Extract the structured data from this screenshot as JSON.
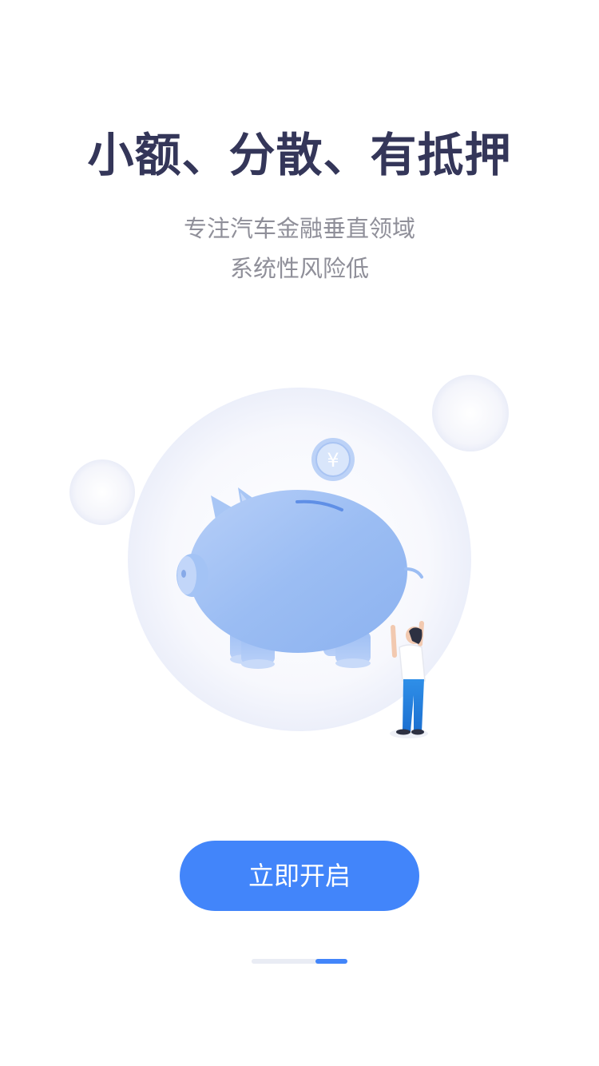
{
  "headline": "小额、分散、有抵押",
  "subtitle": {
    "line1": "专注汽车金融垂直领域",
    "line2": "系统性风险低"
  },
  "illustration": {
    "name": "piggy-bank-illustration",
    "coin_symbol": "¥"
  },
  "cta": {
    "label": "立即开启"
  },
  "pager": {
    "total": 2,
    "active_index": 1
  },
  "colors": {
    "accent": "#4285fa",
    "headline": "#343659",
    "subtitle": "#8f8f99"
  }
}
